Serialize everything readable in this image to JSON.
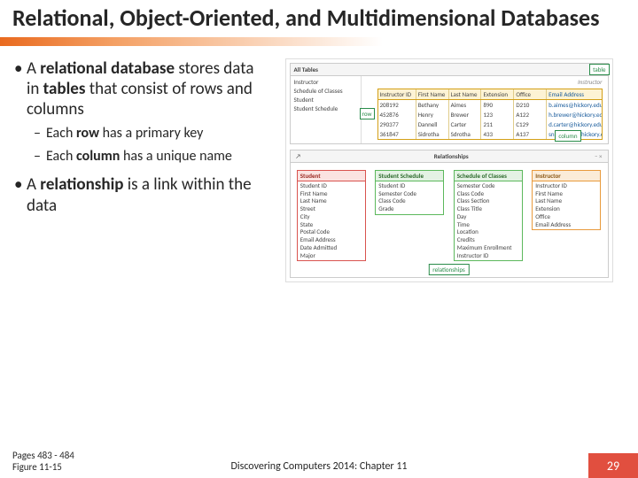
{
  "title": "Relational, Object-Oriented, and Multidimensional Databases",
  "bullets": {
    "b1_pre": "A ",
    "b1_bold1": "relational database",
    "b1_mid1": " stores data in ",
    "b1_bold2": "tables",
    "b1_post": " that consist of rows and columns",
    "b1_sub1_pre": "Each ",
    "b1_sub1_bold": "row",
    "b1_sub1_post": " has a primary key",
    "b1_sub2_pre": "Each ",
    "b1_sub2_bold": "column",
    "b1_sub2_post": " has a unique name",
    "b2_pre": "A ",
    "b2_bold": "relationship",
    "b2_post": " is a link within the data"
  },
  "figure": {
    "all_tables": "All Tables",
    "side_items": [
      "Instructor",
      "Schedule of Classes",
      "Student",
      "Student Schedule"
    ],
    "label_table": "table",
    "label_row": "row",
    "label_column": "column",
    "instructor_panel_title": "Instructor",
    "table_headers": [
      "Instructor ID",
      "First Name",
      "Last Name",
      "Extension",
      "Office",
      "Email Address"
    ],
    "table_rows": [
      [
        "208192",
        "Bethany",
        "Aimes",
        "890",
        "D210",
        "b.aimes@hickory.edu"
      ],
      [
        "452876",
        "Henry",
        "Brewer",
        "123",
        "A122",
        "h.brewer@hickory.edu"
      ],
      [
        "290377",
        "Dannell",
        "Carter",
        "211",
        "C129",
        "d.carter@hickory.edu"
      ],
      [
        "361847",
        "Sidrotha",
        "Sdrotha",
        "433",
        "A137",
        "sn.mankaa@hickory.edu"
      ]
    ],
    "relationships_title": "Relationships",
    "label_relationships": "relationships",
    "rel_boxes": [
      {
        "color": "red",
        "title": "Student",
        "fields": [
          "Student ID",
          "First Name",
          "Last Name",
          "Street",
          "City",
          "State",
          "Postal Code",
          "Email Address",
          "Date Admitted",
          "Major"
        ]
      },
      {
        "color": "green",
        "title": "Student Schedule",
        "fields": [
          "Student ID",
          "Semester Code",
          "Class Code",
          "Grade"
        ]
      },
      {
        "color": "green",
        "title": "Schedule of Classes",
        "fields": [
          "Semester Code",
          "Class Code",
          "Class Section",
          "Class Title",
          "Day",
          "Time",
          "Location",
          "Credits",
          "Maximum Enrollment",
          "Instructor ID"
        ]
      },
      {
        "color": "orange",
        "title": "Instructor",
        "fields": [
          "Instructor ID",
          "First Name",
          "Last Name",
          "Extension",
          "Office",
          "Email Address"
        ]
      }
    ]
  },
  "footer": {
    "pages": "Pages 483 - 484",
    "fig": "Figure 11-15",
    "center": "Discovering Computers 2014: Chapter 11",
    "page_num": "29"
  }
}
